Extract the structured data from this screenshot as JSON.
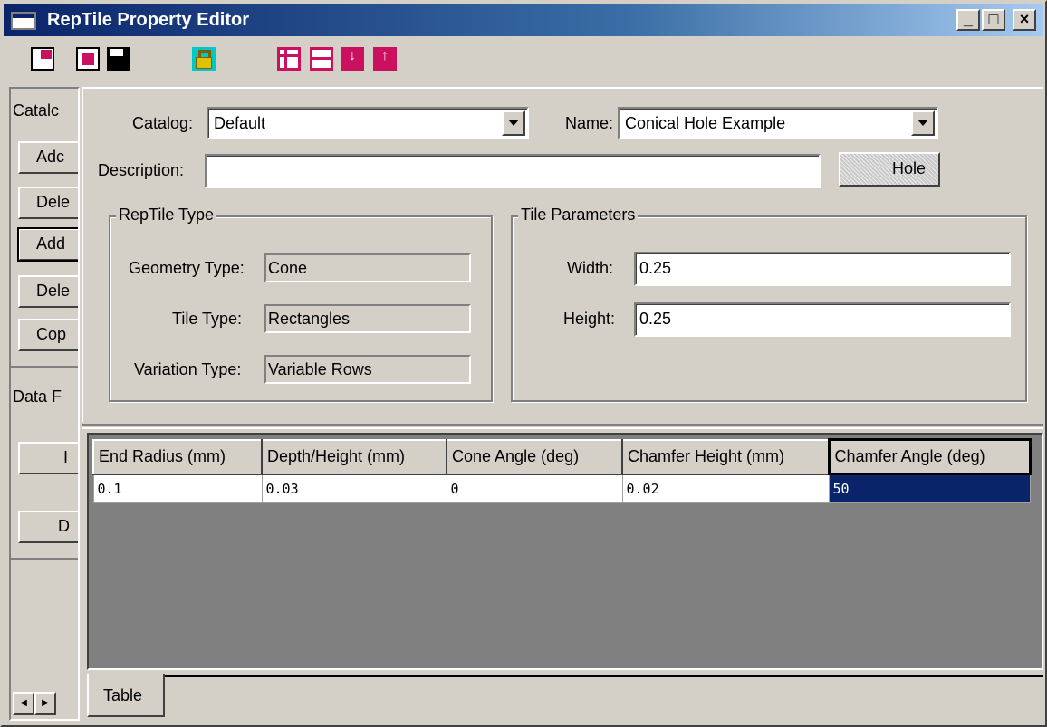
{
  "window": {
    "title": "RepTile Property Editor"
  },
  "left_panel": {
    "catalog_label": "Catalc",
    "buttons": [
      "Adc",
      "Dele",
      "Add",
      "Dele",
      "Cop"
    ],
    "data_label": "Data F",
    "buttons2": [
      "I",
      "D"
    ]
  },
  "form": {
    "catalog_label": "Catalog:",
    "catalog_value": "Default",
    "name_label": "Name:",
    "name_value": "Conical Hole Example",
    "description_label": "Description:",
    "description_value": "",
    "hole_button": "Hole"
  },
  "reptile_type": {
    "title": "RepTile Type",
    "geometry_label": "Geometry Type:",
    "geometry_value": "Cone",
    "tile_label": "Tile Type:",
    "tile_value": "Rectangles",
    "variation_label": "Variation Type:",
    "variation_value": "Variable Rows"
  },
  "tile_parameters": {
    "title": "Tile Parameters",
    "width_label": "Width:",
    "width_value": "0.25",
    "height_label": "Height:",
    "height_value": "0.25"
  },
  "grid": {
    "columns": [
      "End Radius (mm)",
      "Depth/Height (mm)",
      "Cone Angle (deg)",
      "Chamfer Height (mm)",
      "Chamfer Angle (deg)"
    ],
    "rows": [
      [
        "0.1",
        "0.03",
        "0",
        "0.02",
        "50"
      ]
    ]
  },
  "tabs": [
    "Table"
  ],
  "icons": {
    "toolbar": [
      "open-doc-icon",
      "delete-doc-icon",
      "save-icon",
      "lock-icon",
      "table-layout-icon",
      "table-rows-icon",
      "insert-row-below-icon",
      "insert-row-above-icon"
    ]
  },
  "colors": {
    "title_bar": "#0a246a",
    "selection": "#0a246a",
    "toolbar_accent": "#cc1060",
    "face": "#d4d0c8"
  }
}
